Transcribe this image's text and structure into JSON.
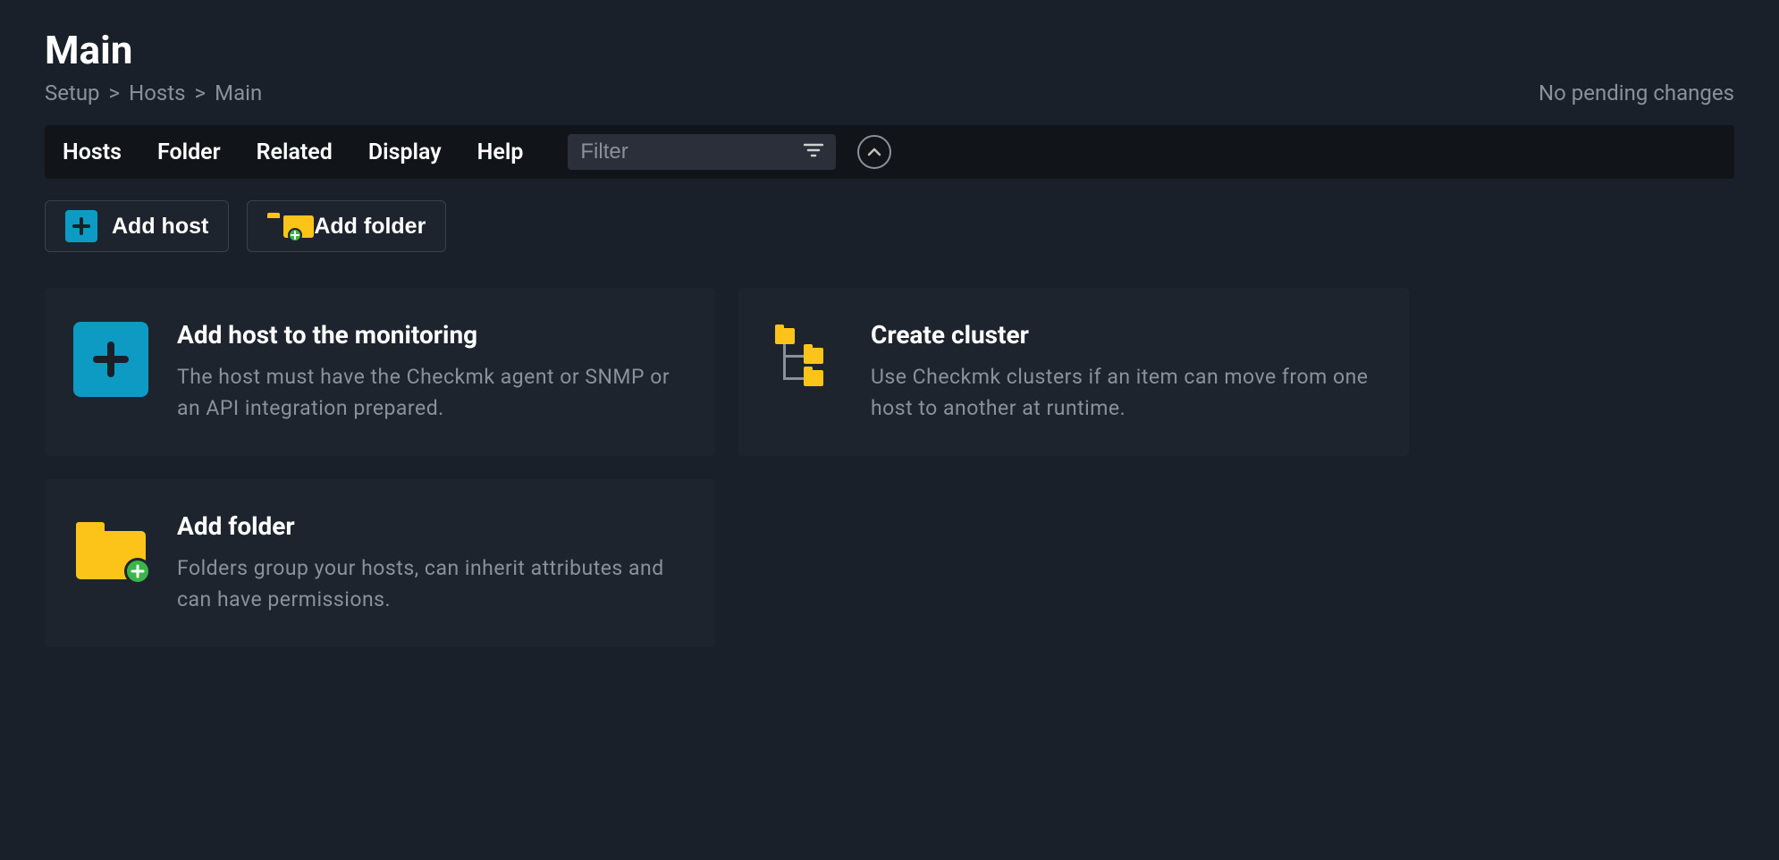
{
  "header": {
    "title": "Main",
    "breadcrumb": [
      "Setup",
      "Hosts",
      "Main"
    ],
    "status": "No pending changes"
  },
  "menubar": {
    "items": [
      "Hosts",
      "Folder",
      "Related",
      "Display",
      "Help"
    ],
    "filter_placeholder": "Filter"
  },
  "actions": {
    "add_host_label": "Add host",
    "add_folder_label": "Add folder"
  },
  "cards": [
    {
      "icon": "plus-large",
      "title": "Add host to the monitoring",
      "desc": "The host must have the Checkmk agent or SNMP or an API integration prepared."
    },
    {
      "icon": "cluster",
      "title": "Create cluster",
      "desc": "Use Checkmk clusters if an item can move from one host to another at runtime."
    },
    {
      "icon": "folder-large",
      "title": "Add folder",
      "desc": "Folders group your hosts, can inherit attributes and can have permissions."
    }
  ]
}
